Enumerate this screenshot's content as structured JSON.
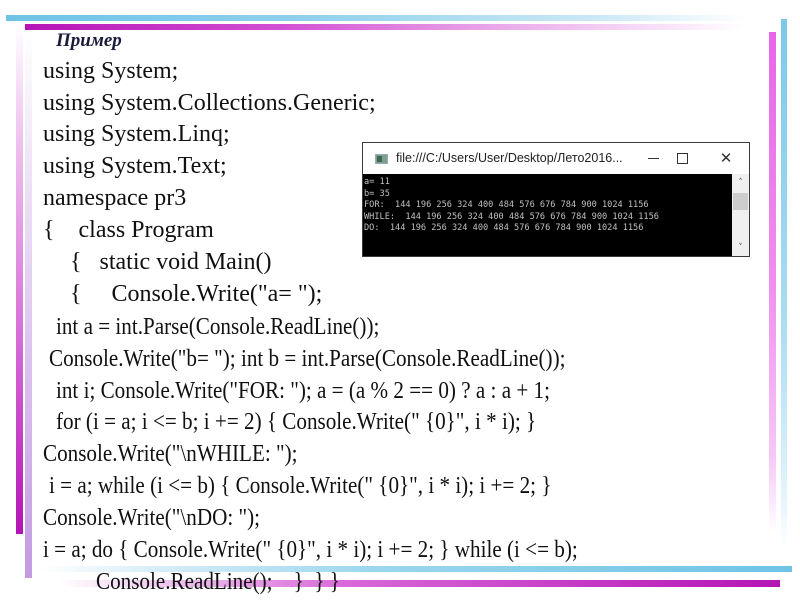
{
  "slide": {
    "title": "Пример",
    "code_lines": [
      "using System;",
      "using System.Collections.Generic;",
      "using System.Linq;",
      "using System.Text;",
      "namespace pr3",
      "{    class Program",
      "{   static void Main()",
      "{     Console.Write(\"a= \");",
      "int a = int.Parse(Console.ReadLine());",
      "Console.Write(\"b= \"); int b = int.Parse(Console.ReadLine());",
      "int i; Console.Write(\"FOR: \"); a = (a % 2 == 0) ? a : a + 1;",
      "for (i = a; i <= b; i += 2) { Console.Write(\" {0}\", i * i); }",
      "Console.Write(\"\\nWHILE: \");",
      "i = a; while (i <= b) { Console.Write(\" {0}\", i * i); i += 2; }",
      "Console.Write(\"\\nDO: \");",
      "i = a; do { Console.Write(\" {0}\", i * i); i += 2; } while (i <= b);",
      "Console.ReadLine();    }  } }"
    ]
  },
  "console_window": {
    "title": "file:///C:/Users/User/Desktop/Лето2016...",
    "icons": {
      "app": "console-app-icon",
      "minimize": "minimize-icon",
      "maximize": "maximize-icon",
      "close": "close-icon",
      "scroll_up": "chevron-up-icon",
      "scroll_down": "chevron-down-icon"
    },
    "close_glyph": "✕",
    "scroll_up_glyph": "˄",
    "scroll_down_glyph": "˅",
    "output_lines": [
      "a= 11",
      "b= 35",
      "FOR:  144 196 256 324 400 484 576 676 784 900 1024 1156",
      "WHILE:  144 196 256 324 400 484 576 676 784 900 1024 1156",
      "DO:  144 196 256 324 400 484 576 676 784 900 1024 1156"
    ]
  },
  "colors": {
    "accent_magenta": "#b514b5",
    "accent_blue": "#6ec3e6",
    "console_bg": "#000000",
    "console_text": "#c0c0c0"
  }
}
